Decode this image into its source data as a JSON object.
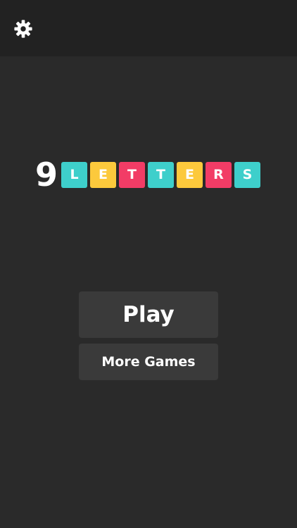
{
  "top_bar": {
    "settings_icon": "gear-icon",
    "icon_color": "#ffffff"
  },
  "logo": {
    "digit": "9",
    "tiles": [
      {
        "letter": "L",
        "color": "#3ecfcb"
      },
      {
        "letter": "E",
        "color": "#fcc93c"
      },
      {
        "letter": "T",
        "color": "#f23c66"
      },
      {
        "letter": "T",
        "color": "#3ecfcb"
      },
      {
        "letter": "E",
        "color": "#fcc93c"
      },
      {
        "letter": "R",
        "color": "#f23c66"
      },
      {
        "letter": "S",
        "color": "#3ecfcb"
      }
    ]
  },
  "menu": {
    "play_label": "Play",
    "more_games_label": "More Games"
  },
  "colors": {
    "background": "#2a2a2a",
    "top_bar": "#222222",
    "button": "#3a3a3a",
    "text": "#ffffff"
  }
}
